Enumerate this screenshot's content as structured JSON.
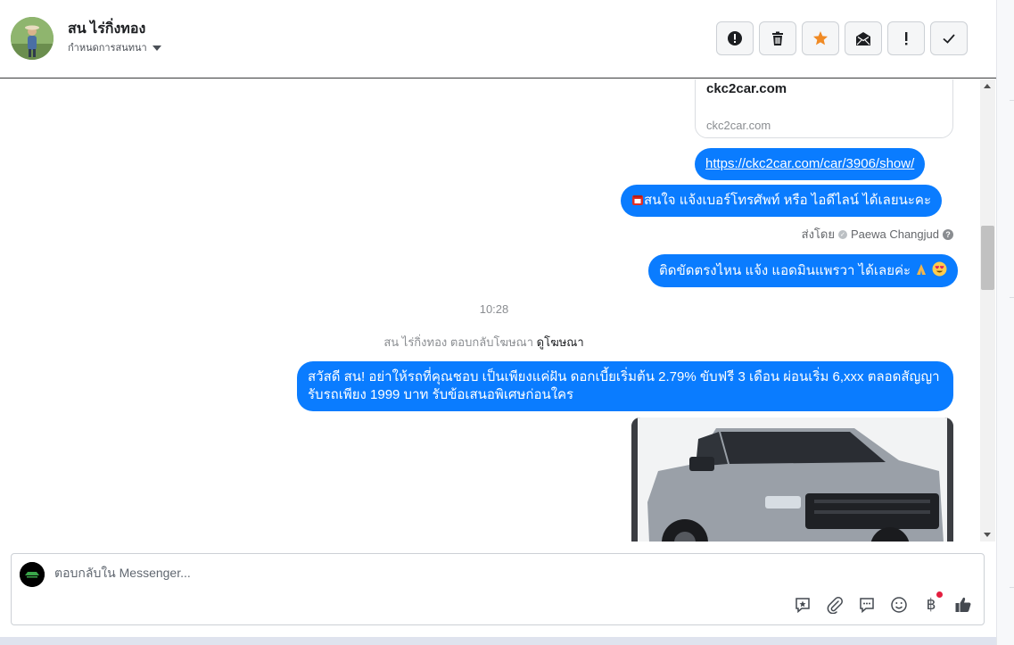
{
  "contact": {
    "name": "สน ไร่กิ่งทอง",
    "assign_label": "กำหนดการสนทนา"
  },
  "toolbar": {
    "buttons": [
      {
        "name": "spam-button",
        "icon": "alert-circle-icon"
      },
      {
        "name": "delete-button",
        "icon": "trash-icon"
      },
      {
        "name": "star-button",
        "icon": "star-icon",
        "color": "#f08a24"
      },
      {
        "name": "mark-unread-button",
        "icon": "envelope-open-icon"
      },
      {
        "name": "follow-up-button",
        "icon": "exclamation-icon"
      },
      {
        "name": "mark-done-button",
        "icon": "check-icon"
      }
    ]
  },
  "thread": {
    "link_card": {
      "title": "ckc2car.com",
      "domain": "ckc2car.com"
    },
    "messages": {
      "link": "https://ckc2car.com/car/3906/show/",
      "interest": "สนใจ แจ้งเบอร์โทรศัพท์ หรือ ไอดีไลน์  ได้เลยนะคะ",
      "stuck": "ติดขัดตรงไหน แจ้ง แอดมินแพรวา ได้เลยค่ะ",
      "promo": "สวัสดี สน! อย่าให้รถที่คุณชอบ เป็นเพียงแค่ฝัน ดอกเบี้ยเริ่มต้น 2.79% ขับฟรี 3 เดือน ผ่อนเริ่ม 6,xxx ตลอดสัญญา รับรถเพียง 1999 บาท รับข้อเสนอพิเศษก่อนใคร"
    },
    "sent_by": {
      "prefix": "ส่งโดย",
      "agent": "Paewa Changjud"
    },
    "time_separator": "10:28",
    "ad_reply": {
      "text": "สน ไร่กิ่งทอง ตอบกลับโฆษณา",
      "link": "ดูโฆษณา"
    }
  },
  "composer": {
    "placeholder": "ตอบกลับใน Messenger...",
    "tools": [
      "saved-reply-icon",
      "attachment-icon",
      "chat-bubble-icon",
      "emoji-icon",
      "baht-payment-icon",
      "like-icon"
    ],
    "baht_symbol": "฿"
  },
  "colors": {
    "bubble": "#0a7cff",
    "star": "#f08a24",
    "notification_dot": "#e41e3f"
  }
}
